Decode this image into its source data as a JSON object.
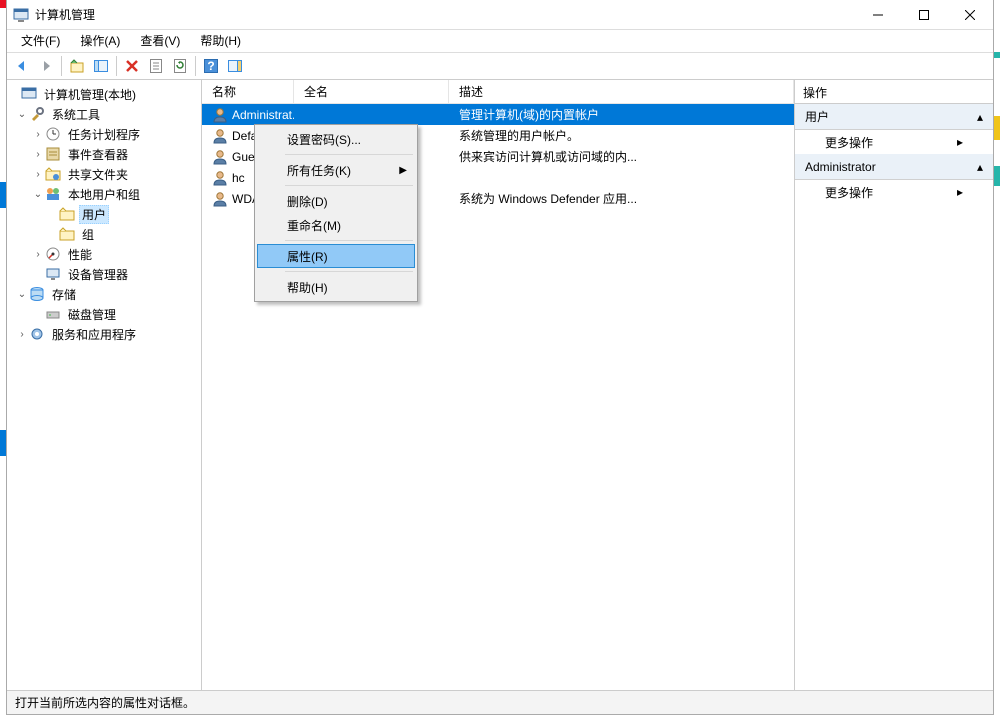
{
  "title": "计算机管理",
  "menu": {
    "file": "文件(F)",
    "action": "操作(A)",
    "view": "查看(V)",
    "help": "帮助(H)"
  },
  "tree": {
    "root": "计算机管理(本地)",
    "systools": "系统工具",
    "sched": "任务计划程序",
    "event": "事件查看器",
    "shared": "共享文件夹",
    "localusers": "本地用户和组",
    "users": "用户",
    "groups": "组",
    "perf": "性能",
    "devmgr": "设备管理器",
    "storage": "存储",
    "diskmgr": "磁盘管理",
    "services": "服务和应用程序"
  },
  "columns": {
    "name": "名称",
    "full": "全名",
    "desc": "描述"
  },
  "rows": [
    {
      "name": "Administrat...",
      "full": "",
      "desc": "管理计算机(域)的内置帐户"
    },
    {
      "name": "Defaul",
      "full": "",
      "desc": "系统管理的用户帐户。"
    },
    {
      "name": "Guest",
      "full": "",
      "desc": "供来宾访问计算机或访问域的内..."
    },
    {
      "name": "hc",
      "full": "",
      "desc": ""
    },
    {
      "name": "WDAG",
      "full": "",
      "desc": "系统为 Windows Defender 应用..."
    }
  ],
  "context": {
    "setpwd": "设置密码(S)...",
    "alltasks": "所有任务(K)",
    "delete": "删除(D)",
    "rename": "重命名(M)",
    "props": "属性(R)",
    "help": "帮助(H)"
  },
  "actions": {
    "title": "操作",
    "sec1": "用户",
    "more": "更多操作",
    "sec2": "Administrator"
  },
  "status": "打开当前所选内容的属性对话框。"
}
